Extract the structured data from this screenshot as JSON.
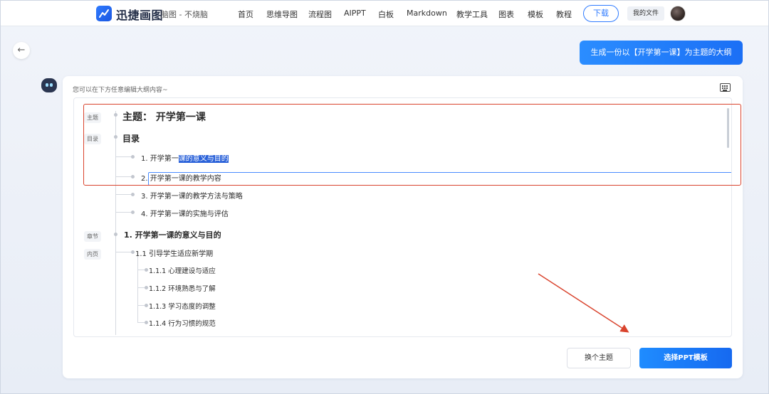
{
  "app": {
    "brand": "迅捷画图",
    "doc_name": "脑图 - 不烧脑"
  },
  "nav": [
    "首页",
    "思维导图",
    "流程图",
    "AIPPT",
    "白板",
    "Markdown",
    "教学工具",
    "图表",
    "模板",
    "教程"
  ],
  "header": {
    "download_label": "下载",
    "my_files_label": "我的文件"
  },
  "prompt": "生成一份以【开学第一课】为主题的大纲",
  "card": {
    "hint": "您可以在下方任意编辑大纲内容~",
    "tags": {
      "topic": "主题",
      "toc": "目录",
      "chapter": "章节",
      "page": "内页"
    },
    "topic_title": "主题：   开学第一课",
    "toc_title": "目录",
    "toc_items": [
      {
        "prefix": "1. 开学第一",
        "selected": "课的意义与目的"
      },
      "2. 开学第一课的教学内容",
      "3. 开学第一课的教学方法与策略",
      "4. 开学第一课的实施与评估"
    ],
    "chapter_title": "1. 开学第一课的意义与目的",
    "section_title": "1.1 引导学生适应新学期",
    "sub_items": [
      "1.1.1 心理建设与适应",
      "1.1.2 环境熟悉与了解",
      "1.1.3 学习态度的调整",
      "1.1.4 行为习惯的规范"
    ],
    "change_theme_label": "换个主题",
    "choose_ppt_label": "选择PPT模板"
  },
  "colors": {
    "accent": "#1f7bff",
    "annotation_red": "#d9442e",
    "selection": "#2b62d9"
  }
}
